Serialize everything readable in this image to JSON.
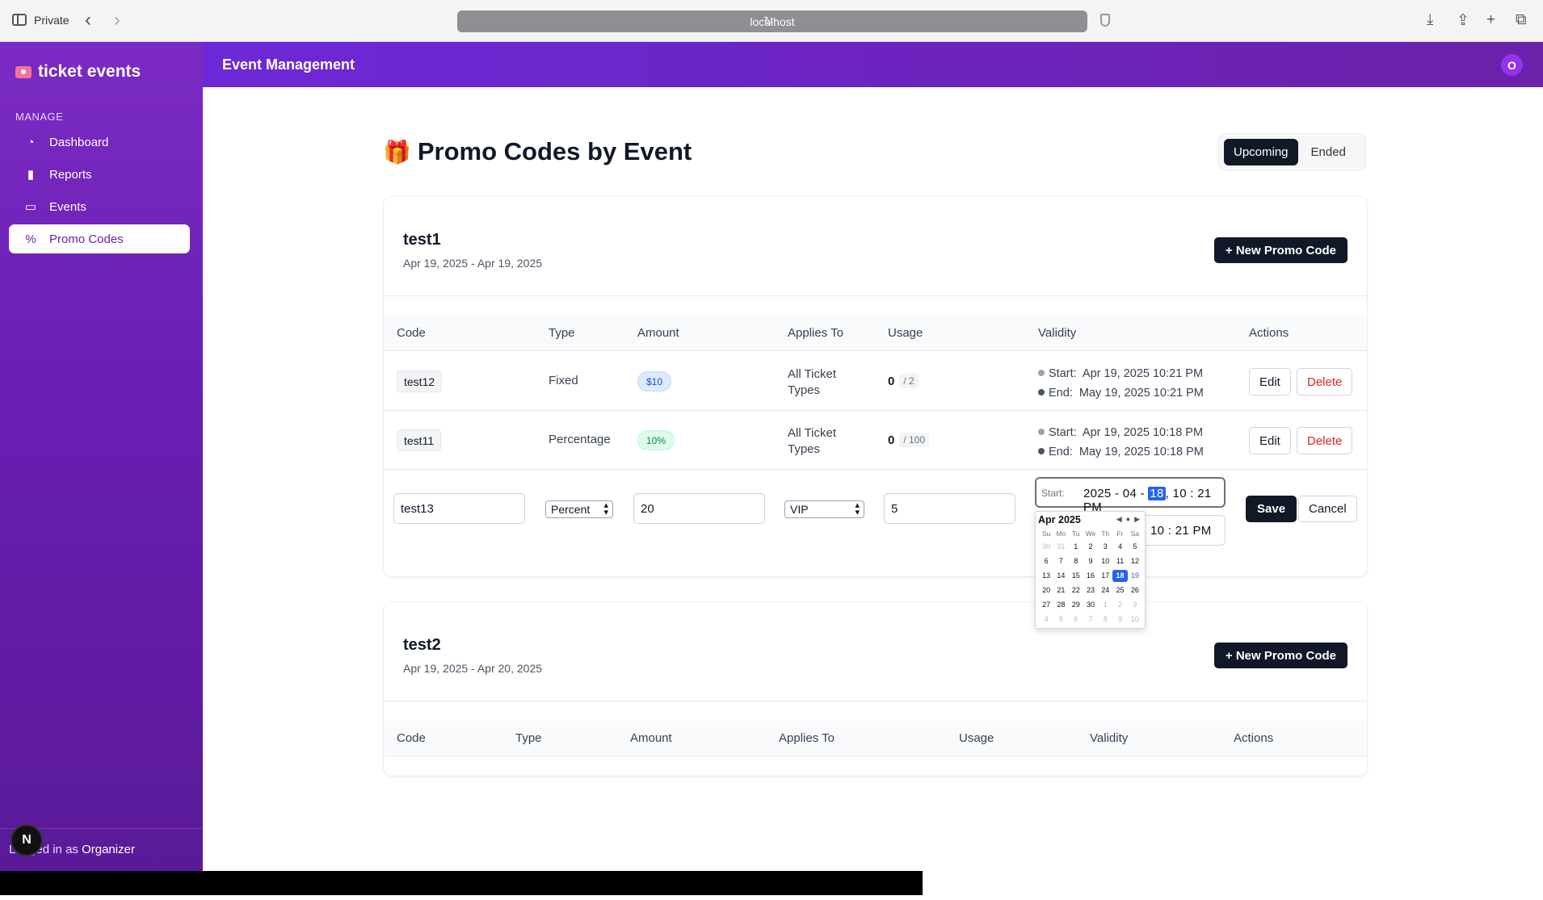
{
  "browser": {
    "private_label": "Private",
    "url": "localhost"
  },
  "sidebar": {
    "brand": "ticket events",
    "section_label": "MANAGE",
    "items": [
      {
        "label": "Dashboard",
        "icon": "gauge-icon"
      },
      {
        "label": "Reports",
        "icon": "bar-chart-icon"
      },
      {
        "label": "Events",
        "icon": "ticket-icon"
      },
      {
        "label": "Promo Codes",
        "icon": "percent-icon",
        "active": true
      }
    ],
    "logged_prefix": "Logged in as ",
    "logged_role": "Organizer",
    "n_badge": "N"
  },
  "header": {
    "title": "Event Management",
    "avatar_initial": "O"
  },
  "main": {
    "page_title": "Promo Codes by Event",
    "tabs": [
      {
        "label": "Upcoming",
        "active": true
      },
      {
        "label": "Ended",
        "active": false
      }
    ]
  },
  "events": [
    {
      "name": "test1",
      "dates": "Apr 19, 2025 - Apr 19, 2025",
      "new_button": "+ New Promo Code",
      "columns": [
        "Code",
        "Type",
        "Amount",
        "Applies To",
        "Usage",
        "Validity",
        "Actions"
      ],
      "rows": [
        {
          "code": "test12",
          "type": "Fixed",
          "amount": "$10",
          "applies_to": "All Ticket Types",
          "usage_used": "0",
          "usage_max": "/ 2",
          "start_label": "Start:",
          "start": "Apr 19, 2025 10:21 PM",
          "end_label": "End:",
          "end": "May 19, 2025 10:21 PM",
          "edit": "Edit",
          "delete": "Delete"
        },
        {
          "code": "test11",
          "type": "Percentage",
          "amount": "10%",
          "applies_to": "All Ticket Types",
          "usage_used": "0",
          "usage_max": "/ 100",
          "start_label": "Start:",
          "start": "Apr 19, 2025 10:18 PM",
          "end_label": "End:",
          "end": "May 19, 2025 10:18 PM",
          "edit": "Edit",
          "delete": "Delete"
        }
      ],
      "edit_row": {
        "code": "test13",
        "type_selected": "Percent",
        "amount": "20",
        "applies_selected": "VIP",
        "usage_limit": "5",
        "start_label": "Start:",
        "start_date_prefix": "2025 - 04 - ",
        "start_day": "18",
        "start_time": ", 10 : 21  PM",
        "end_visible": "9 , 10 : 21  PM",
        "save": "Save",
        "cancel": "Cancel"
      }
    },
    {
      "name": "test2",
      "dates": "Apr 19, 2025 - Apr 20, 2025",
      "new_button": "+ New Promo Code",
      "columns": [
        "Code",
        "Type",
        "Amount",
        "Applies To",
        "Usage",
        "Validity",
        "Actions"
      ]
    }
  ],
  "calendar": {
    "month": "Apr 2025",
    "weekdays": [
      "Su",
      "Mo",
      "Tu",
      "We",
      "Th",
      "Fr",
      "Sa"
    ],
    "days": [
      "30",
      "31",
      "1",
      "2",
      "3",
      "4",
      "5",
      "6",
      "7",
      "8",
      "9",
      "10",
      "11",
      "12",
      "13",
      "14",
      "15",
      "16",
      "17",
      "18",
      "19",
      "20",
      "21",
      "22",
      "23",
      "24",
      "25",
      "26",
      "27",
      "28",
      "29",
      "30",
      "1",
      "2",
      "3",
      "4",
      "5",
      "6",
      "7",
      "8",
      "9",
      "10"
    ],
    "selected": "18",
    "today": "19"
  },
  "colors": {
    "sidebar": "#6a1fb4",
    "header": "#6d28d9",
    "primary_button": "#111827",
    "danger": "#dc2626"
  }
}
